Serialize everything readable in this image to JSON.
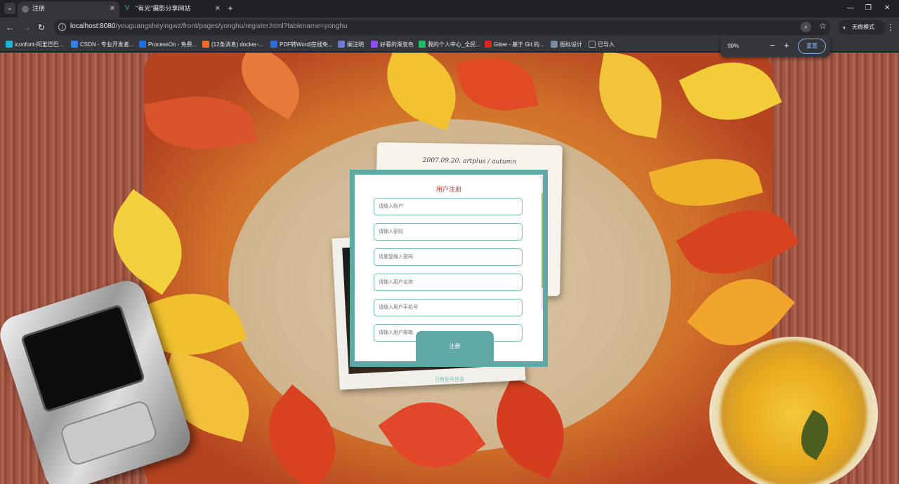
{
  "browser": {
    "tabs": [
      {
        "title": "注册",
        "active": true
      },
      {
        "title": "\"有光\"摄影分享网站",
        "active": false
      }
    ],
    "new_tab_label": "+",
    "window_controls": {
      "minimize": "—",
      "restore": "❐",
      "close": "✕"
    },
    "url_host": "localhost:8080",
    "url_path": "/youguangsheyingwz/front/pages/yonghu/register.html?tablename=yonghu",
    "incognito_label": "无痕模式",
    "bookmarks": [
      {
        "label": "iconfont-阿里巴巴...",
        "color": "#1fb6d6"
      },
      {
        "label": "CSDN - 专业开发者...",
        "color": "#2f7ff0"
      },
      {
        "label": "ProcessOn - 免费...",
        "color": "#1f6fe0"
      },
      {
        "label": "(12条消息) docker-...",
        "color": "#f06a35"
      },
      {
        "label": "PDF转Word|在线免...",
        "color": "#2a6fd6"
      },
      {
        "label": "阑汪明",
        "color": "#6e7bd8"
      },
      {
        "label": "好看的渐变色",
        "color": "#8a4ff0"
      },
      {
        "label": "我的个人中心_全民...",
        "color": "#1fbf6a"
      },
      {
        "label": "Gitee - 基于 Git 的...",
        "color": "#d7261e"
      },
      {
        "label": "图标设计",
        "color": "#7a8aa0"
      },
      {
        "label": "已导入",
        "color": "#9aa0a6"
      }
    ]
  },
  "zoom_popup": {
    "percent": "90%",
    "minus": "−",
    "plus": "+",
    "reset_label": "重置"
  },
  "page": {
    "photo_caption": "2007.09.20. artplus / autumn",
    "form": {
      "title": "用户注册",
      "fields": [
        {
          "placeholder": "请输入账户"
        },
        {
          "placeholder": "请输入密码"
        },
        {
          "placeholder": "请重复输入密码"
        },
        {
          "placeholder": "请输入用户名称"
        },
        {
          "placeholder": "请输入用户手机号"
        },
        {
          "placeholder": "请输入用户邮箱"
        }
      ],
      "submit_label": "注册",
      "login_link": "已有账号登录"
    }
  }
}
